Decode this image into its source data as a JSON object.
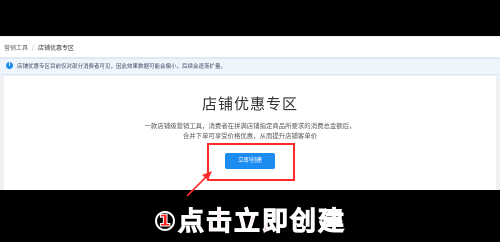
{
  "breadcrumb": {
    "parent": "营销工具",
    "separator": "/",
    "current": "店铺优惠专区"
  },
  "notice": {
    "icon": "info-icon",
    "text": "店铺优惠专区目前仅对部分消费者可见，因此效果数据可能会偏小，后续会逐渐扩量。"
  },
  "main": {
    "title": "店铺优惠专区",
    "description_line1": "一款店铺级营销工具，消费者在拼满店铺指定商品所要求的消费总金额后，",
    "description_line2": "合并下单可享受价格优惠，从而提升店铺客单价",
    "create_button": "立即创建"
  },
  "annotation": {
    "caption": "①点击立即创建",
    "color": "#ff1f1f"
  },
  "colors": {
    "accent": "#1c8cf0",
    "highlight": "#ff2a2a"
  }
}
